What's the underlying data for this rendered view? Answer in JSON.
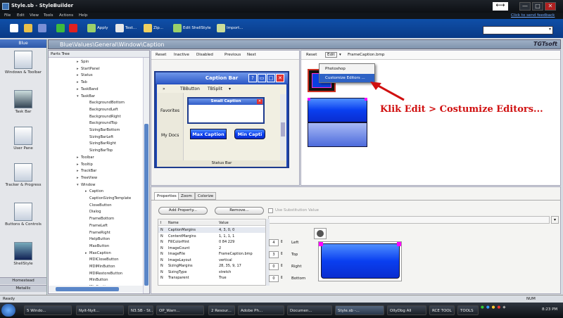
{
  "window": {
    "title": "Style.sb - StyleBuilder",
    "send_feedback": "Click to send feedback",
    "controls": [
      "—",
      "□",
      "✕"
    ]
  },
  "menu": [
    "File",
    "Edit",
    "View",
    "Tools",
    "Actions",
    "Help"
  ],
  "toolbar": [
    {
      "label": "",
      "icon": "new-icon",
      "color": "#ffffff"
    },
    {
      "label": "",
      "icon": "open-icon",
      "color": "#e8c04a"
    },
    {
      "label": "",
      "icon": "save-icon",
      "color": "#7a8fd6"
    },
    {
      "label": "",
      "icon": "add-icon",
      "color": "#3dbb3d"
    },
    {
      "label": "",
      "icon": "delete-icon",
      "color": "#e02020"
    },
    {
      "label": "Apply",
      "icon": "apply-icon",
      "color": "#9bd06a"
    },
    {
      "label": "Test...",
      "icon": "test-icon",
      "color": "#e8e8e8"
    },
    {
      "label": "Zip...",
      "icon": "zip-icon",
      "color": "#f0d060"
    },
    {
      "label": "Edit ShellStyle",
      "icon": "edit-shellstyle-icon",
      "color": "#9bd06a"
    },
    {
      "label": "Import...",
      "icon": "import-icon",
      "color": "#ccdd99"
    }
  ],
  "left_pane": {
    "header": "Blue",
    "items": [
      "Windows & Toolbar",
      "Task Bar",
      "User Pane",
      "Tracker & Progress",
      "Buttons & Controls",
      "ShellStyle"
    ],
    "footer_items": [
      "Homestead",
      "Metallic"
    ]
  },
  "path": "Blue\\Values\\General\\Window\\Caption",
  "logo": "TGTsoft",
  "parts_tree": {
    "title": "Parts Tree",
    "nodes": [
      {
        "label": "Spin",
        "level": 0,
        "exp": "▸"
      },
      {
        "label": "StartPanel",
        "level": 0,
        "exp": "▸"
      },
      {
        "label": "Status",
        "level": 0,
        "exp": "▸"
      },
      {
        "label": "Tab",
        "level": 0,
        "exp": "▸"
      },
      {
        "label": "TaskBand",
        "level": 0,
        "exp": "▸"
      },
      {
        "label": "TaskBar",
        "level": 0,
        "exp": "▾"
      },
      {
        "label": "BackgroundBottom",
        "level": 1,
        "exp": ""
      },
      {
        "label": "BackgroundLeft",
        "level": 1,
        "exp": ""
      },
      {
        "label": "BackgroundRight",
        "level": 1,
        "exp": ""
      },
      {
        "label": "BackgroundTop",
        "level": 1,
        "exp": ""
      },
      {
        "label": "SizingBarBottom",
        "level": 1,
        "exp": ""
      },
      {
        "label": "SizingBarLeft",
        "level": 1,
        "exp": ""
      },
      {
        "label": "SizingBarRight",
        "level": 1,
        "exp": ""
      },
      {
        "label": "SizingBarTop",
        "level": 1,
        "exp": ""
      },
      {
        "label": "Toolbar",
        "level": 0,
        "exp": "▸"
      },
      {
        "label": "Tooltip",
        "level": 0,
        "exp": "▸"
      },
      {
        "label": "TrackBar",
        "level": 0,
        "exp": "▸"
      },
      {
        "label": "TreeView",
        "level": 0,
        "exp": "▸"
      },
      {
        "label": "Window",
        "level": 0,
        "exp": "▾"
      },
      {
        "label": "Caption",
        "level": 1,
        "exp": "▸"
      },
      {
        "label": "CaptionSizingTemplate",
        "level": 1,
        "exp": ""
      },
      {
        "label": "CloseButton",
        "level": 1,
        "exp": ""
      },
      {
        "label": "Dialog",
        "level": 1,
        "exp": ""
      },
      {
        "label": "FrameBottom",
        "level": 1,
        "exp": ""
      },
      {
        "label": "FrameLeft",
        "level": 1,
        "exp": ""
      },
      {
        "label": "FrameRight",
        "level": 1,
        "exp": ""
      },
      {
        "label": "HelpButton",
        "level": 1,
        "exp": ""
      },
      {
        "label": "MaxButton",
        "level": 1,
        "exp": ""
      },
      {
        "label": "MaxCaption",
        "level": 1,
        "exp": "▸"
      },
      {
        "label": "MDICloseButton",
        "level": 1,
        "exp": ""
      },
      {
        "label": "MDIMinButton",
        "level": 1,
        "exp": ""
      },
      {
        "label": "MDIRestoreButton",
        "level": 1,
        "exp": ""
      },
      {
        "label": "MinButton",
        "level": 1,
        "exp": ""
      },
      {
        "label": "MinCaption",
        "level": 1,
        "exp": ""
      }
    ]
  },
  "preview": {
    "buttons": [
      "Reset",
      "Inactive",
      "Disabled",
      "Previous",
      "Next"
    ],
    "caption_bar": "Caption Bar",
    "caption_buttons": [
      "?",
      "▭",
      "□",
      "✕"
    ],
    "toolbar": [
      "»",
      "TBButton",
      "TBSplit",
      "▾"
    ],
    "side_items": [
      "Favorites",
      "My Docs"
    ],
    "small_caption": "Small Caption",
    "max_caption": "Max Caption",
    "min_caption": "Min Capti",
    "status_bar": "Status Bar"
  },
  "editor": {
    "reset": "Reset",
    "edit": "Edit",
    "file": "FrameCaption.bmp",
    "menu": [
      "Photoshop",
      "Customize Editors ..."
    ]
  },
  "annotation": "Klik Edit > Costumize Editors...",
  "properties": {
    "tabs": [
      "Properties",
      "Zoom",
      "Colorize"
    ],
    "add": "Add Property...",
    "remove": "Remove...",
    "use_substitution": "Use Substitution Value",
    "columns": [
      "I",
      "Name",
      "Value"
    ],
    "rows": [
      {
        "i": "N",
        "name": "CaptionMargins",
        "value": "4, 3, 0, 0"
      },
      {
        "i": "N",
        "name": "ContentMargins",
        "value": "1, 1, 1, 1"
      },
      {
        "i": "N",
        "name": "FillColorHint",
        "value": "0 84 229"
      },
      {
        "i": "N",
        "name": "ImageCount",
        "value": "2"
      },
      {
        "i": "N",
        "name": "ImageFile",
        "value": "FrameCaption.bmp"
      },
      {
        "i": "N",
        "name": "ImageLayout",
        "value": "vertical"
      },
      {
        "i": "N",
        "name": "SizingMargins",
        "value": "28, 35, 9, 17"
      },
      {
        "i": "N",
        "name": "SizingType",
        "value": "stretch"
      },
      {
        "i": "N",
        "name": "Transparent",
        "value": "True"
      }
    ],
    "spinners": [
      {
        "label": "Left",
        "value": "4"
      },
      {
        "label": "Top",
        "value": "3"
      },
      {
        "label": "Right",
        "value": "0"
      },
      {
        "label": "Bottom",
        "value": "0"
      }
    ]
  },
  "status": {
    "left": "Ready",
    "right": "NUM"
  },
  "taskbar": {
    "items": [
      "5 Windo...",
      "Nyit-Nyit...",
      "N3.SB - St...",
      "OP_Warn...",
      "2 Resour...",
      "Adobe Ph...",
      "Documen...",
      "Style.sb -...",
      "OllyDbg All",
      "RCE TOOL",
      "TOOLS"
    ],
    "clock": "8:23 PM"
  }
}
